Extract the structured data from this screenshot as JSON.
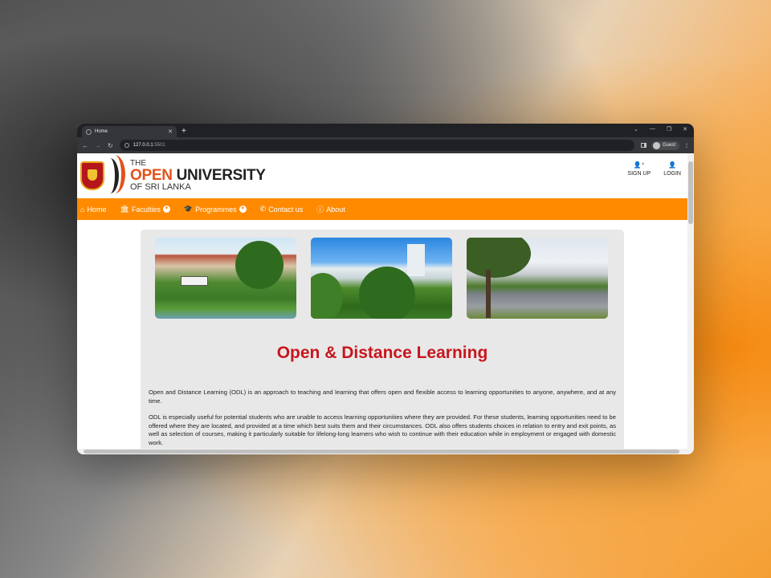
{
  "browser": {
    "tab_title": "Home",
    "new_tab": "+",
    "url_host": "127.0.0.1",
    "url_port": ":5501",
    "profile": "Guest",
    "nav_back": "←",
    "nav_forward": "→",
    "nav_reload": "↻",
    "win_min": "—",
    "win_restore": "❐",
    "win_close": "✕",
    "tab_close": "✕",
    "menu": "⋮"
  },
  "header": {
    "brand_the": "THE",
    "brand_open": "OPEN",
    "brand_university": " UNIVERSITY",
    "brand_sub": "OF SRI LANKA",
    "signup_label": "SIGN UP",
    "login_label": "LOGIN"
  },
  "navbar": {
    "items": [
      {
        "label": "Home",
        "icon": "home-icon"
      },
      {
        "label": "Faculties",
        "icon": "building-icon"
      },
      {
        "label": "Programmes",
        "icon": "graduation-cap-icon"
      },
      {
        "label": "Contact us",
        "icon": "phone-icon"
      },
      {
        "label": "About",
        "icon": "info-icon"
      }
    ]
  },
  "main": {
    "heading": "Open & Distance Learning",
    "paragraph1": "Open and Distance Learning (ODL) is an approach to teaching and learning that offers open and flexible access to learning opportunities to anyone, anywhere, and at any time.",
    "paragraph2": "ODL is especially useful for potential students who are unable to access learning opportunities where they are provided. For these students, learning opportunities need to be offered where they are located, and provided at a time which best suits them and their circumstances. ODL also offers students choices in relation to entry and exit points, as well as selection of courses, making it particularly suitable for lifelong-long learners who wish to continue with their education while in employment or engaged with domestic work."
  },
  "colors": {
    "accent": "#ff8a00",
    "heading": "#c8161d",
    "brand_orange": "#e2531b"
  }
}
